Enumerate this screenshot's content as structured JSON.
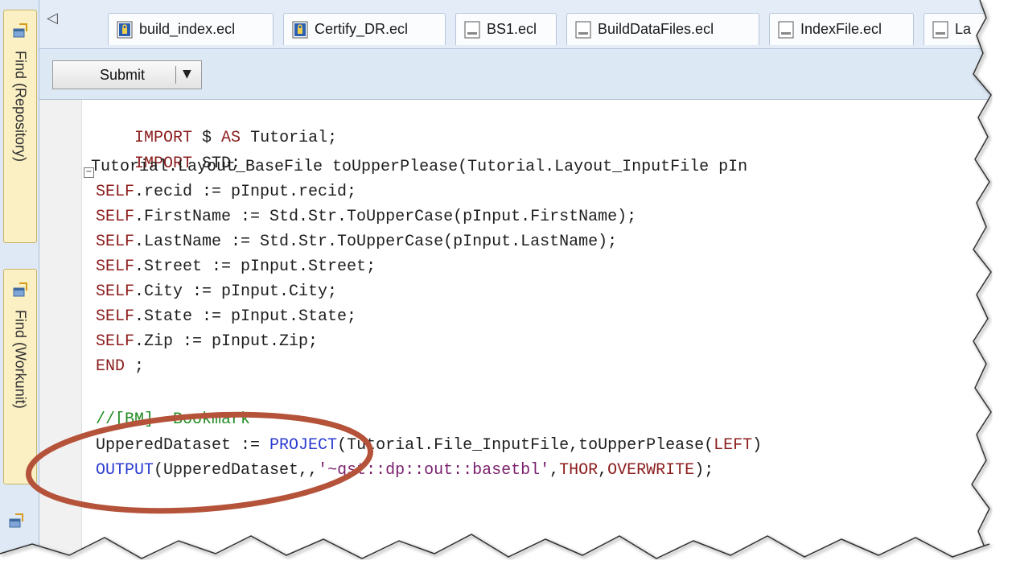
{
  "left_panel": {
    "find_repository_label": "Find (Repository)",
    "find_workunit_label": "Find (Workunit)"
  },
  "tabs": [
    {
      "label": "build_index.ecl",
      "icon": "locked-file-icon"
    },
    {
      "label": "Certify_DR.ecl",
      "icon": "locked-file-icon"
    },
    {
      "label": "BS1.ecl",
      "icon": "file-icon"
    },
    {
      "label": "BuildDataFiles.ecl",
      "icon": "file-icon"
    },
    {
      "label": "IndexFile.ecl",
      "icon": "file-icon"
    },
    {
      "label": "La",
      "icon": "file-icon"
    }
  ],
  "toolbar": {
    "submit_label": "Submit",
    "dropdown_arrow": "▼"
  },
  "editor": {
    "lines": [
      "IMPORT $ AS Tutorial;",
      "IMPORT STD;",
      "Tutorial.Layout_BaseFile toUpperPlease(Tutorial.Layout_InputFile pIn",
      "SELF.recid := pInput.recid;",
      "SELF.FirstName := Std.Str.ToUpperCase(pInput.FirstName);",
      "SELF.LastName := Std.Str.ToUpperCase(pInput.LastName);",
      "SELF.Street := pInput.Street;",
      "SELF.City := pInput.City;",
      "SELF.State := pInput.State;",
      "SELF.Zip := pInput.Zip;",
      "END ;",
      "",
      "//[BM]  Bookmark",
      "UpperedDataset := PROJECT(Tutorial.File_InputFile,toUpperPlease(LEFT)",
      "OUTPUT(UpperedDataset,,'~qst::dp::out::basetbl',THOR,OVERWRITE);"
    ]
  },
  "colors": {
    "keyword": "#8b1c1c",
    "comment": "#228b22",
    "function": "#2a3bd0",
    "string": "#7a1f6e",
    "highlight_ellipse": "#b5533a"
  }
}
